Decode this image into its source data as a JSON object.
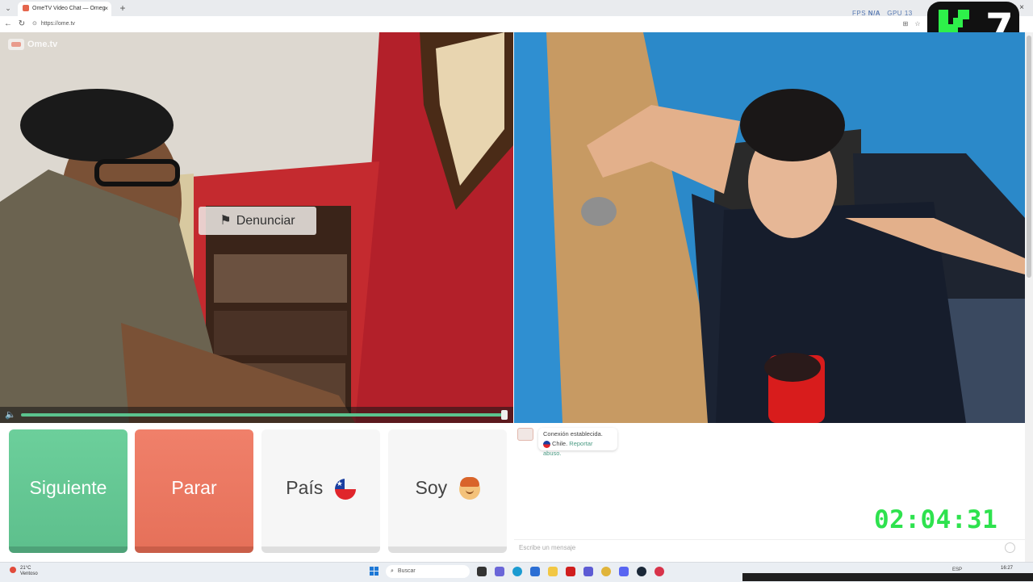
{
  "browser": {
    "tabs": [
      {
        "title": "OmeTV Video Chat — Omeg",
        "active": true
      },
      {
        "title": "",
        "active": false
      }
    ],
    "new_tab_symbol": "+",
    "tab_close_symbol": "×",
    "url": "https://ome.tv",
    "window_controls": {
      "close": "×"
    },
    "fps_label": "FPS",
    "fps_value": "N/A",
    "gpu_label": "GPU",
    "gpu_value": "13"
  },
  "stream_logo": {
    "number": "7",
    "accent_color": "#2ef04a"
  },
  "app": {
    "brand": "Ome.tv",
    "report_button": "Denunciar",
    "buttons": {
      "next": "Siguiente",
      "stop": "Parar",
      "country": "País",
      "gender": "Soy"
    },
    "colors": {
      "next": "#6ccf9b",
      "stop": "#f0806a",
      "accent": "#5ec08d"
    }
  },
  "chat": {
    "message_line1": "Conexión establecida.",
    "message_country": "Chile.",
    "message_link": "Reportar abuso.",
    "input_placeholder": "Escribe un mensaje"
  },
  "overlay_timer": "02:04:31",
  "taskbar": {
    "weather_temp": "21°C",
    "weather_desc": "Ventoso",
    "search_placeholder": "Buscar",
    "lang": "ESP",
    "time": "16:27"
  }
}
